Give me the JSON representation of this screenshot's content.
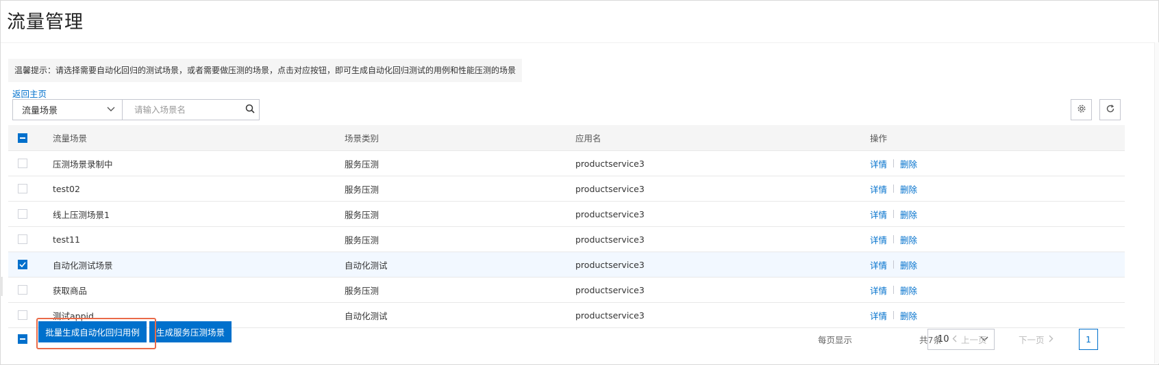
{
  "page": {
    "title": "流量管理"
  },
  "tip": "温馨提示：请选择需要自动化回归的测试场景，或者需要做压测的场景，点击对应按钮，即可生成自动化回归测试的用例和性能压测的场景",
  "nav": {
    "back_label": "返回主页"
  },
  "filter": {
    "select_value": "流量场景",
    "search_placeholder": "请输入场景名"
  },
  "toolbar": {
    "settings_icon": "gear-icon",
    "refresh_icon": "refresh-icon"
  },
  "table": {
    "columns": [
      "流量场景",
      "场景类别",
      "应用名",
      "操作"
    ],
    "rows": [
      {
        "name": "压测场景录制中",
        "type": "服务压测",
        "app": "productservice3",
        "checked": false
      },
      {
        "name": "test02",
        "type": "服务压测",
        "app": "productservice3",
        "checked": false
      },
      {
        "name": "线上压测场景1",
        "type": "服务压测",
        "app": "productservice3",
        "checked": false
      },
      {
        "name": "test11",
        "type": "服务压测",
        "app": "productservice3",
        "checked": false
      },
      {
        "name": "自动化测试场景",
        "type": "自动化测试",
        "app": "productservice3",
        "checked": true
      },
      {
        "name": "获取商品",
        "type": "服务压测",
        "app": "productservice3",
        "checked": false
      },
      {
        "name": "测试appid",
        "type": "自动化测试",
        "app": "productservice3",
        "checked": false
      }
    ],
    "actions": {
      "detail": "详情",
      "delete": "删除"
    }
  },
  "footer": {
    "batch_regression_label": "批量生成自动化回归用例",
    "stress_scene_label": "生成服务压测场景"
  },
  "pagination": {
    "per_page_label": "每页显示",
    "per_page_value": "10",
    "total_label": "共7条",
    "prev_label": "上一页",
    "next_label": "下一页",
    "current_page": "1"
  },
  "colors": {
    "accent": "#0070cc",
    "highlight": "#e96a48"
  }
}
